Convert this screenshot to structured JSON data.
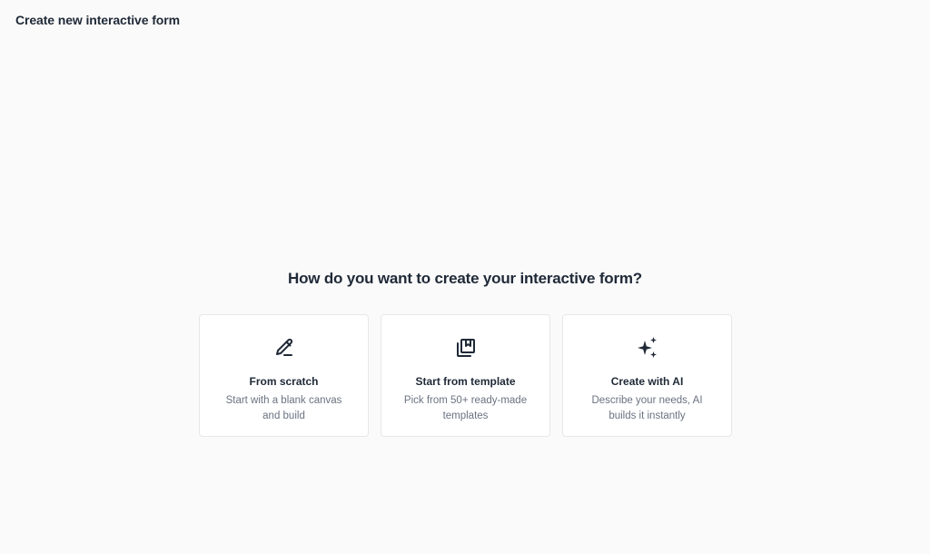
{
  "header": {
    "title": "Create new interactive form"
  },
  "main": {
    "question": "How do you want to create your interactive form?",
    "options": [
      {
        "icon": "pencil-icon",
        "label": "From scratch",
        "description": "Start with a blank canvas and build"
      },
      {
        "icon": "template-icon",
        "label": "Start from template",
        "description": "Pick from 50+ ready-made templates"
      },
      {
        "icon": "sparkles-icon",
        "label": "Create with AI",
        "description": "Describe your needs, AI builds it instantly"
      }
    ]
  },
  "colors": {
    "background": "#fafafa",
    "card": "#ffffff",
    "border": "#e5e7eb",
    "text": "#1f2937",
    "muted": "#6b7280"
  }
}
